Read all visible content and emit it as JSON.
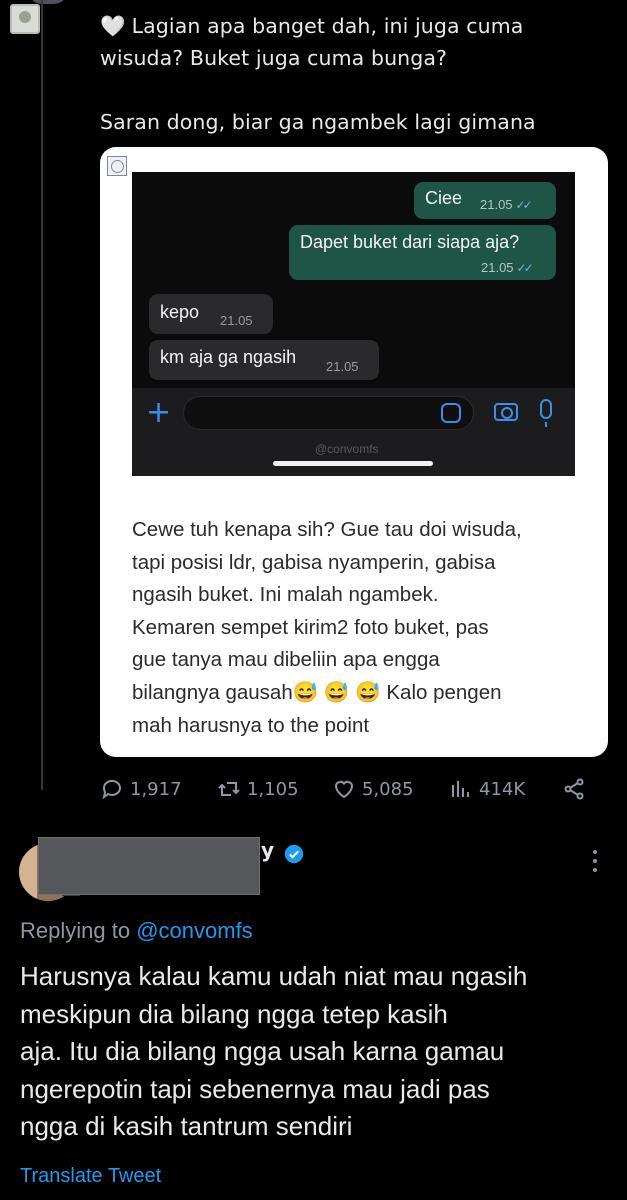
{
  "tweet": {
    "heart_emoji": "🤍",
    "line1": "Lagian apa banget dah, ini juga cuma",
    "line2": "wisuda? Buket juga cuma bunga?",
    "line3": "Saran dong, biar ga ngambek lagi gimana"
  },
  "chat": {
    "messages": [
      {
        "direction": "outgoing",
        "text": "Ciee",
        "time": "21.05"
      },
      {
        "direction": "outgoing",
        "text": "Dapet buket dari siapa aja?",
        "time": "21.05"
      },
      {
        "direction": "incoming",
        "text": "kepo",
        "time": "21.05"
      },
      {
        "direction": "incoming",
        "text": "km aja ga ngasih",
        "time": "21.05"
      }
    ],
    "plus_symbol": "+",
    "watermark": "@convomfs"
  },
  "card_text": [
    "Cewe tuh kenapa sih? Gue tau doi wisuda,",
    "tapi posisi ldr, gabisa nyamperin, gabisa",
    "ngasih buket. Ini malah ngambek.",
    "Kemaren sempet kirim2 foto buket, pas",
    "gue tanya mau dibeliin apa engga",
    "bilangnya gausah😅 😅 😅 Kalo pengen",
    "mah harusnya to the point"
  ],
  "actions": {
    "replies": "1,917",
    "retweets": "1,105",
    "likes": "5,085",
    "views": "414K"
  },
  "reply": {
    "name_visible_suffix": "y",
    "replying_prefix": "Replying to",
    "replying_handle": "@convomfs",
    "lines": [
      "Harusnya kalau kamu udah niat mau ngasih",
      "meskipun dia bilang ngga tetep kasih",
      "aja. Itu dia bilang ngga usah karna gamau",
      "ngerepotin tapi sebenernya mau jadi pas",
      "ngga di kasih tantrum sendiri"
    ],
    "translate_label": "Translate Tweet"
  },
  "colors": {
    "background": "#000000",
    "link_blue": "#1d9bf0",
    "muted": "#8b98a5",
    "bubble_out": "#1f5546",
    "bubble_in": "#2a2a2c"
  }
}
